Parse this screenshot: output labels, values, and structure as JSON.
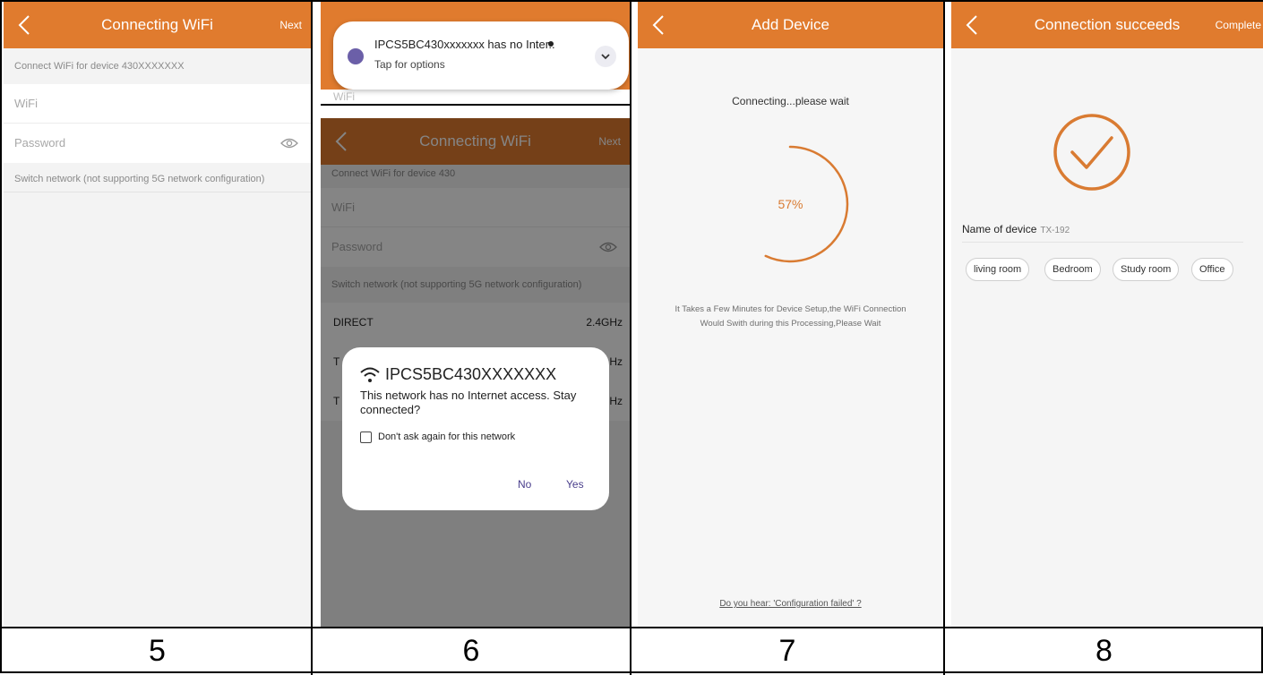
{
  "panel5": {
    "header": {
      "title": "Connecting WiFi",
      "action": "Next"
    },
    "subheader": "Connect WiFi for device 430XXXXXXX",
    "wifi_placeholder": "WiFi",
    "password_placeholder": "Password",
    "switch_network": "Switch network (not supporting 5G network configuration)",
    "step": "5"
  },
  "panel6": {
    "header": {
      "title": "Connecting WiFi",
      "action": "Next"
    },
    "subheader": "Connect WiFi for device 430",
    "wifi_placeholder": "WiFi",
    "password_placeholder": "Password",
    "switch_network": "Switch network (not supporting 5G network configuration)",
    "network_list": [
      {
        "name": "DIRECT",
        "band": "2.4GHz"
      },
      {
        "name": "T",
        "band": "Hz"
      },
      {
        "name": "T",
        "band": "Hz"
      }
    ],
    "notification": {
      "line1": "IPCS5BC430xxxxxxx has no Inter..",
      "line2": "Tap for options",
      "peek_text": "WiFi"
    },
    "dialog": {
      "title": "IPCS5BC430XXXXXXX",
      "message": "This network has no Internet access. Stay connected?",
      "checkbox_label": "Don't ask again for this network",
      "checkbox_checked": false,
      "no_label": "No",
      "yes_label": "Yes"
    },
    "step": "6"
  },
  "panel7": {
    "header": {
      "title": "Add Device"
    },
    "status": "Connecting...please wait",
    "progress_label": "57%",
    "progress_value": 0.57,
    "info": "It Takes a Few Minutes for Device Setup,the WiFi Connection Would Swith during this Processing,Please Wait",
    "help_link": "Do you hear: 'Configuration failed' ?",
    "step": "7"
  },
  "panel8": {
    "header": {
      "title": "Connection succeeds",
      "action": "Complete"
    },
    "device_label": "Name of device",
    "device_name": "TX-192",
    "rooms": [
      "living room",
      "Bedroom",
      "Study room",
      "Office"
    ],
    "step": "8"
  },
  "colors": {
    "accent": "#e07b2e",
    "progress": "#d97b32",
    "dialog_button": "#4a3f8c"
  },
  "icons": {
    "back": "chevron-left-icon",
    "eye": "eye-icon",
    "wifi": "wifi-icon",
    "success": "check-circle-icon",
    "expand": "chevron-down-icon"
  }
}
